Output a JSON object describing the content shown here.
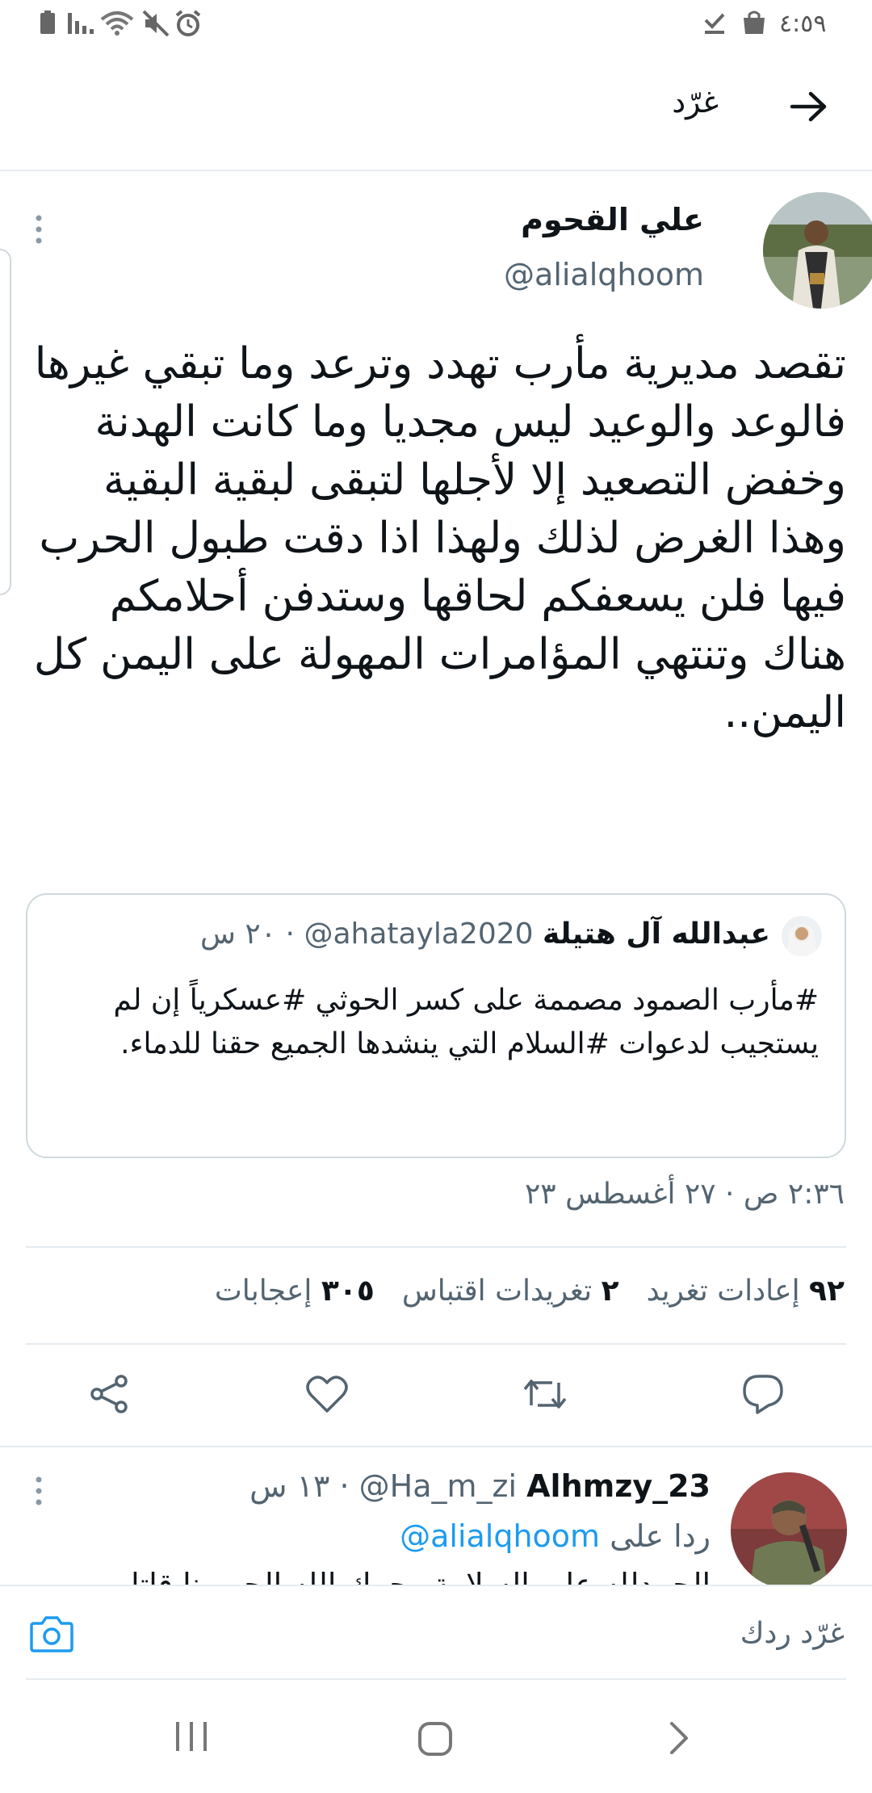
{
  "status_bar": {
    "time": "٤:٥٩",
    "icons": [
      "battery-icon",
      "signal-icon",
      "wifi-icon",
      "mute-icon",
      "alarm-icon",
      "download-done-icon",
      "shopping-bag-icon"
    ]
  },
  "header": {
    "title": "غرّد",
    "back_icon": "arrow-right-icon"
  },
  "tweet": {
    "author_name": "علي القحوم",
    "author_handle": "@alialqhoom",
    "text": "تقصد مديرية مأرب تهدد وترعد وما تبقي غيرها فالوعد والوعيد ليس مجديا وما كانت الهدنة وخفض التصعيد إلا لأجلها لتبقى لبقية البقية وهذا الغرض لذلك ولهذا اذا دقت طبول الحرب فيها فلن يسعفكم لحاقها وستدفن أحلامكم هناك وتنتهي المؤامرات المهولة على اليمن كل اليمن..",
    "quoted": {
      "name": "عبدالله آل هتيلة",
      "handle": "@ahatayla2020",
      "time": "· ٢٠ س",
      "text": "#مأرب الصمود مصممة على كسر الحوثي #عسكرياً إن لم يستجيب لدعوات #السلام التي ينشدها الجميع حقنا للدماء."
    },
    "timestamp": "٢:٣٦ ص · ٢٧ أغسطس ٢٣",
    "stats": {
      "retweets_count": "٩٢",
      "retweets_label": "إعادات تغريد",
      "quotes_count": "٢",
      "quotes_label": "تغريدات اقتباس",
      "likes_count": "٣٠٥",
      "likes_label": "إعجابات"
    },
    "actions": [
      "reply-icon",
      "retweet-icon",
      "like-icon",
      "share-icon"
    ]
  },
  "reply": {
    "name": "Alhmzy_23",
    "handle": "@Ha_m_zi",
    "time": "· ١٣ س",
    "replying_prefix": "ردا على",
    "replying_to": "@alialqhoom",
    "text_peek": "الحمدلله على السلامة رحمك الله الحر منا قاتلو"
  },
  "composer": {
    "placeholder": "غرّد ردك",
    "icon": "camera-icon"
  },
  "nav_bar": {
    "buttons": [
      "recents-button",
      "home-button",
      "back-button"
    ]
  },
  "colors": {
    "accent": "#1d9bf0",
    "text_primary": "#0f1419",
    "text_secondary": "#536471",
    "border": "#cfd9de"
  }
}
